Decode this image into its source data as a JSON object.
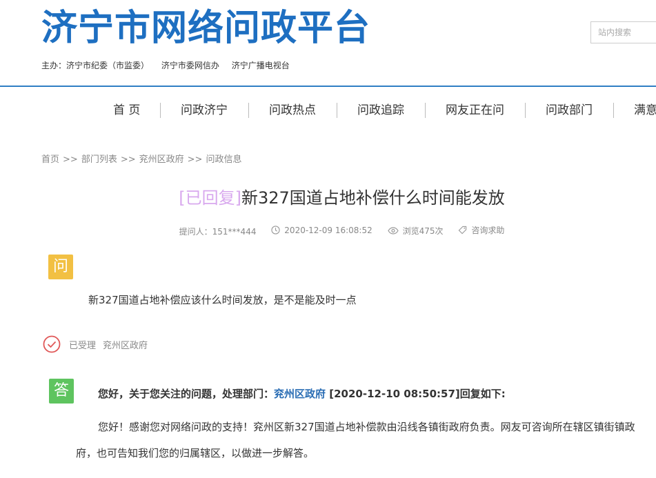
{
  "header": {
    "site_title": "济宁市网络问政平台",
    "sponsors": [
      "主办：济宁市纪委（市监委）",
      "济宁市委网信办",
      "济宁广播电视台"
    ],
    "search_placeholder": "站内搜索"
  },
  "nav": {
    "items": [
      "首 页",
      "问政济宁",
      "问政热点",
      "问政追踪",
      "网友正在问",
      "问政部门",
      "满意"
    ]
  },
  "breadcrumb": {
    "items": [
      "首页",
      "部门列表",
      "兖州区政府",
      "问政信息"
    ],
    "separator": ">>"
  },
  "question": {
    "status": "[已回复]",
    "title": "新327国道占地补偿什么时间能发放",
    "asker": "提问人：151***444",
    "time": "2020-12-09 16:08:52",
    "views": "浏览475次",
    "category": "咨询求助",
    "badge": "问",
    "content": "新327国道占地补偿应该什么时间发放，是不是能及时一点"
  },
  "acceptance": {
    "status": "已受理",
    "department": "兖州区政府"
  },
  "answer": {
    "badge": "答",
    "head_prefix": "您好，关于您关注的问题，处理部门：",
    "department": "兖州区政府",
    "head_suffix": "[2020-12-10 08:50:57]回复如下:",
    "content": "您好！感谢您对网络问政的支持！兖州区新327国道占地补偿款由沿线各镇街政府负责。网友可咨询所在辖区镇街镇政府，也可告知我们您的归属辖区，以做进一步解答。"
  },
  "colors": {
    "brand_blue": "#1e6fc1",
    "status_purple": "#d8a8ee",
    "question_badge": "#f2c043",
    "answer_badge": "#5ec45f",
    "check_red": "#e05757"
  }
}
